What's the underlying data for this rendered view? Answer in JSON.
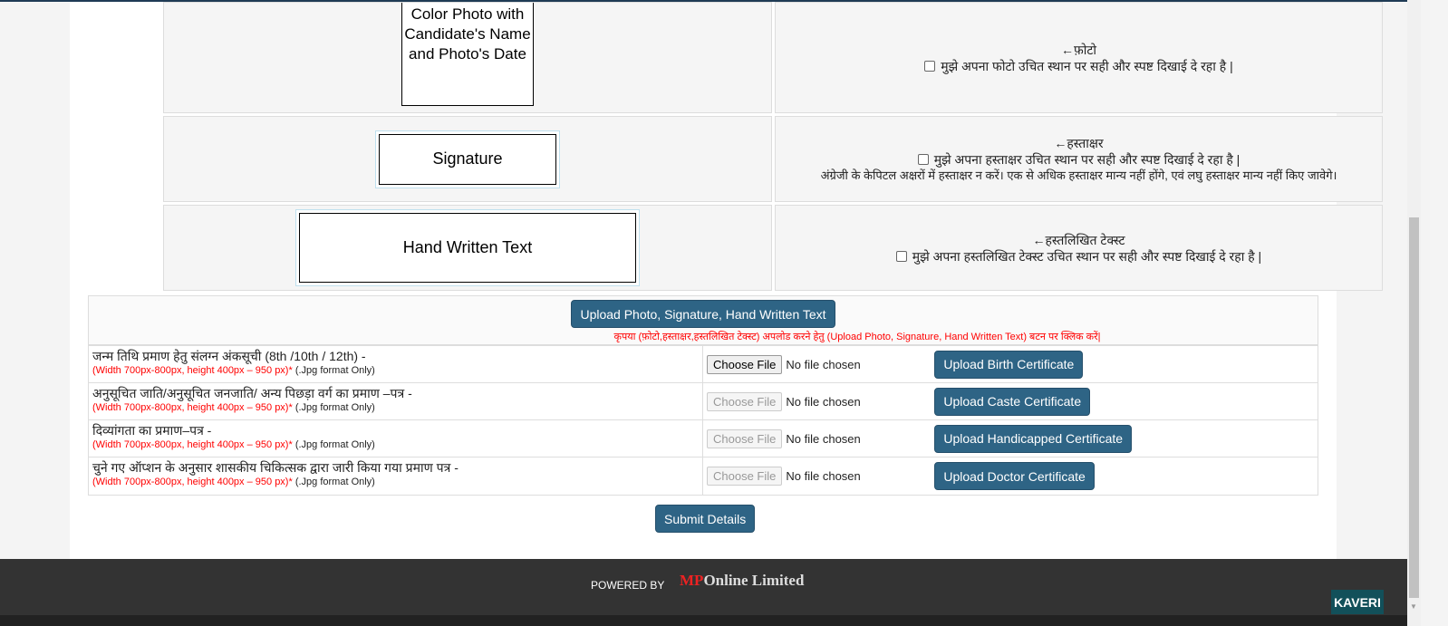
{
  "photo": {
    "placeholder": "Color Photo with Candidate's Name and Photo's Date",
    "arrow_label": "←फ़ोटो",
    "confirm": "मुझे अपना फोटो उचित स्थान पर सही और स्पष्ट दिखाई दे रहा है |"
  },
  "signature": {
    "placeholder": "Signature",
    "arrow_label": "←हस्ताक्षर",
    "confirm": "मुझे अपना हस्ताक्षर उचित स्थान पर सही और स्पष्ट दिखाई दे रहा है |",
    "note": "अंग्रेजी के केपिटल अक्षरों में हस्ताक्षर न करें। एक से अधिक हस्ताक्षर मान्य नहीं होंगे, एवं लघु हस्ताक्षर मान्य नहीं किए जावेगे।"
  },
  "handwritten": {
    "placeholder": "Hand Written Text",
    "arrow_label": "←हस्तलिखित टेक्स्ट",
    "confirm": "मुझे अपना हस्तलिखित टेक्स्ट उचित स्थान पर सही और स्पष्ट दिखाई दे रहा है |"
  },
  "upload_main": {
    "label": "Upload Photo, Signature, Hand Written Text",
    "note": "कृपया (फ़ोटो,हस्ताक्षर,हस्तलिखित टेक्स्ट) अपलोड करने हेतु (Upload Photo, Signature, Hand Written Text) बटन पर क्लिक करें|"
  },
  "certificates": [
    {
      "title": "जन्म तिथि प्रमाण हेतु संलग्न अंकसूची (8th /10th / 12th) -",
      "size": "(Width 700px-800px, height 400px – 950 px)*",
      "format": " (.Jpg format Only)",
      "choose": "Choose File",
      "status": "No file chosen",
      "button": "Upload Birth Certificate",
      "enabled": true
    },
    {
      "title": "अनुसूचित जाति/अनुसूचित जनजाति/ अन्य पिछड़ा वर्ग का प्रमाण –पत्र -",
      "size": "(Width 700px-800px, height 400px – 950 px)*",
      "format": " (.Jpg format Only)",
      "choose": "Choose File",
      "status": "No file chosen",
      "button": "Upload Caste Certificate",
      "enabled": false
    },
    {
      "title": "दिव्यांगता का प्रमाण–पत्र -",
      "size": "(Width 700px-800px, height 400px – 950 px)*",
      "format": " (.Jpg format Only)",
      "choose": "Choose File",
      "status": "No file chosen",
      "button": "Upload Handicapped Certificate",
      "enabled": false
    },
    {
      "title": "चुने गए ऑप्शन के अनुसार शासकीय चिकित्सक द्वारा जारी किया गया प्रमाण पत्र -",
      "size": "(Width 700px-800px, height 400px – 950 px)*",
      "format": " (.Jpg format Only)",
      "choose": "Choose File",
      "status": "No file chosen",
      "button": "Upload Doctor Certificate",
      "enabled": false
    }
  ],
  "submit": "Submit Details",
  "footer": {
    "powered_by": "POWERED BY",
    "logo_text": "MPOnline Limited",
    "kaveri": "KAVERI"
  },
  "colors": {
    "button": "#2e6485",
    "footer": "#333333",
    "warning": "#ff0000"
  }
}
